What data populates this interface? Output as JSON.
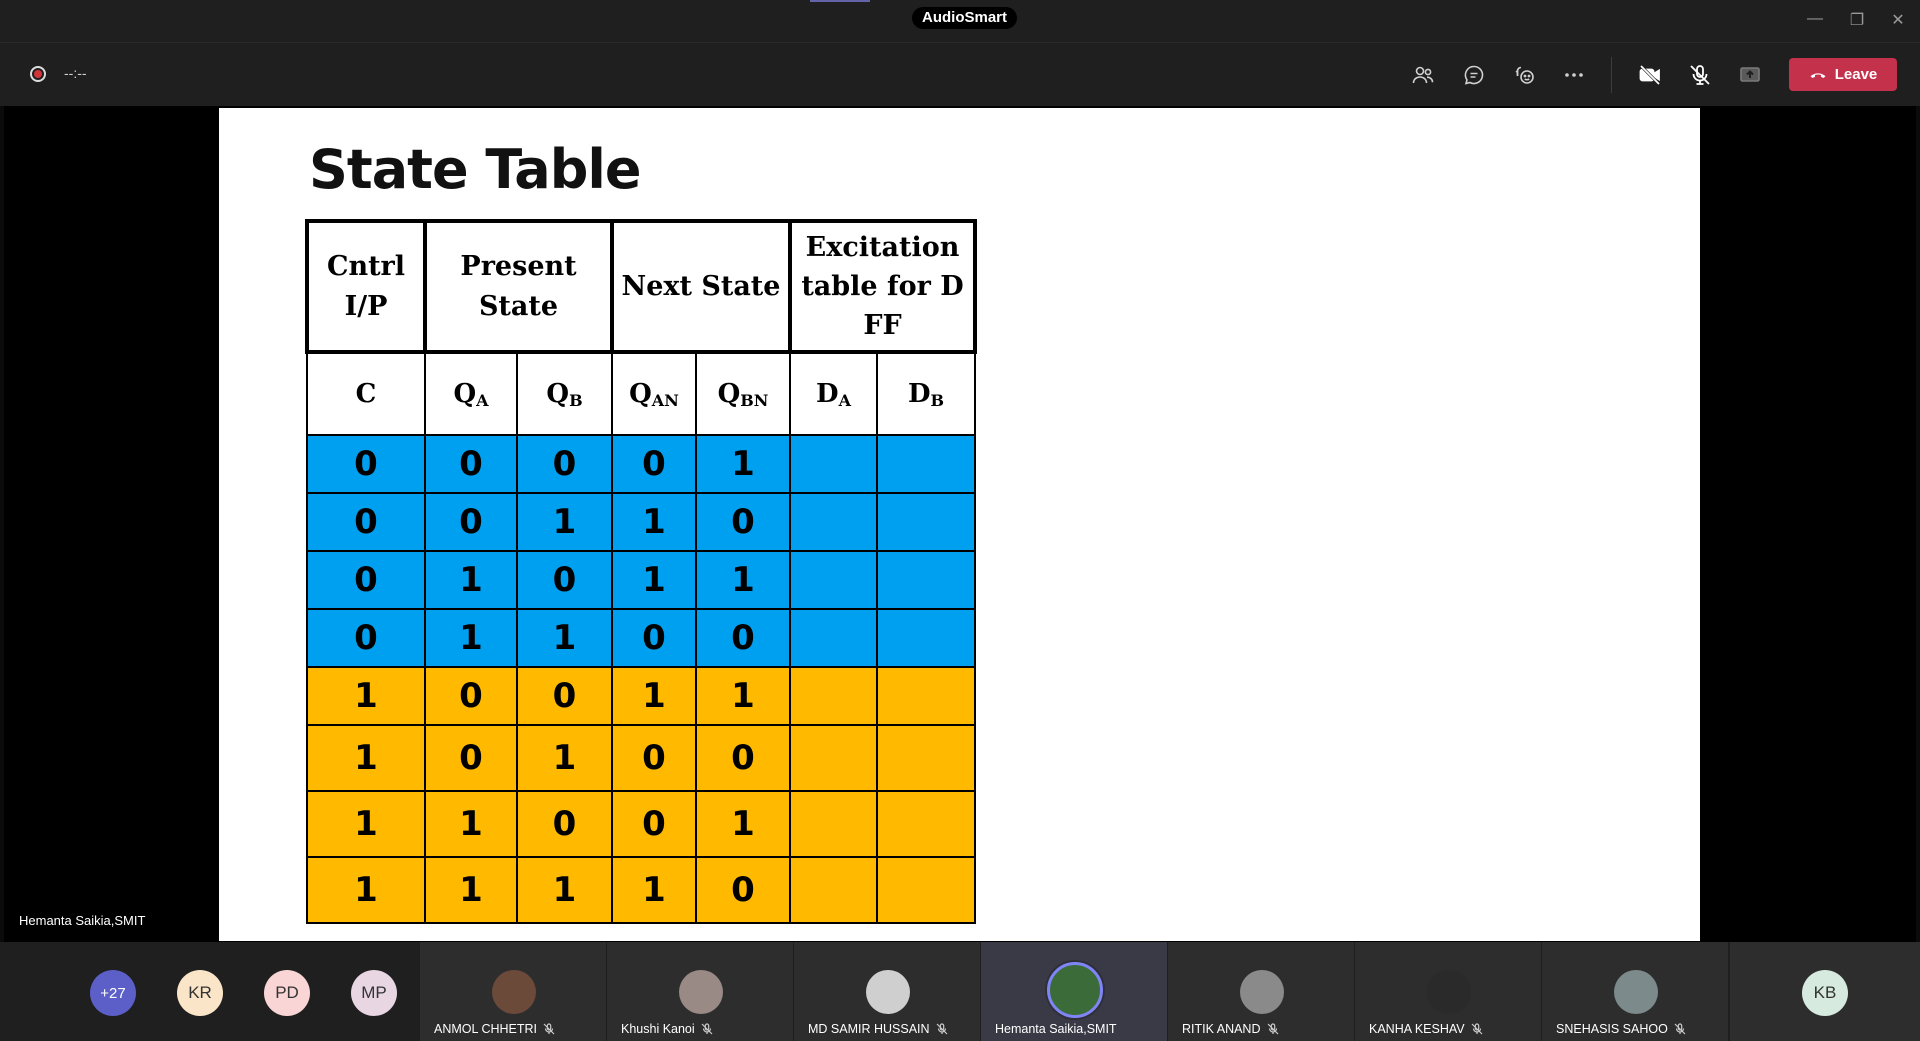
{
  "window": {
    "app_title": "AudioSmart"
  },
  "toolbar": {
    "timer": "--:--",
    "leave_label": "Leave"
  },
  "slide": {
    "title": "State Table",
    "headers": {
      "cntrl": "Cntrl I/P",
      "present": "Present State",
      "next": "Next State",
      "excitation": "Excitation table for D FF",
      "c": "C",
      "qa": "Q",
      "qa_sub": "A",
      "qb": "Q",
      "qb_sub": "B",
      "qan": "Q",
      "qan_sub": "AN",
      "qbn": "Q",
      "qbn_sub": "BN",
      "da": "D",
      "da_sub": "A",
      "db": "D",
      "db_sub": "B"
    },
    "rows": [
      [
        "0",
        "0",
        "0",
        "0",
        "1"
      ],
      [
        "0",
        "0",
        "1",
        "1",
        "0"
      ],
      [
        "0",
        "1",
        "0",
        "1",
        "1"
      ],
      [
        "0",
        "1",
        "1",
        "0",
        "0"
      ],
      [
        "1",
        "0",
        "0",
        "1",
        "1"
      ],
      [
        "1",
        "0",
        "1",
        "0",
        "0"
      ],
      [
        "1",
        "1",
        "0",
        "0",
        "1"
      ],
      [
        "1",
        "1",
        "1",
        "1",
        "0"
      ]
    ]
  },
  "presenter": {
    "name": "Hemanta Saikia,SMIT"
  },
  "strip": {
    "overflow": "+27",
    "initials": [
      "KR",
      "PD",
      "MP"
    ],
    "tiles": [
      "ANMOL CHHETRI",
      "Khushi Kanoi",
      "MD SAMIR HUSSAIN",
      "Hemanta Saikia,SMIT",
      "RITIK ANAND",
      "KANHA KESHAV",
      "SNEHASIS SAHOO"
    ],
    "last_initials": "KB"
  },
  "colors": {
    "blue_rows": "#00a0f0",
    "gold_rows": "#ffba00",
    "leave": "#c4314b"
  }
}
